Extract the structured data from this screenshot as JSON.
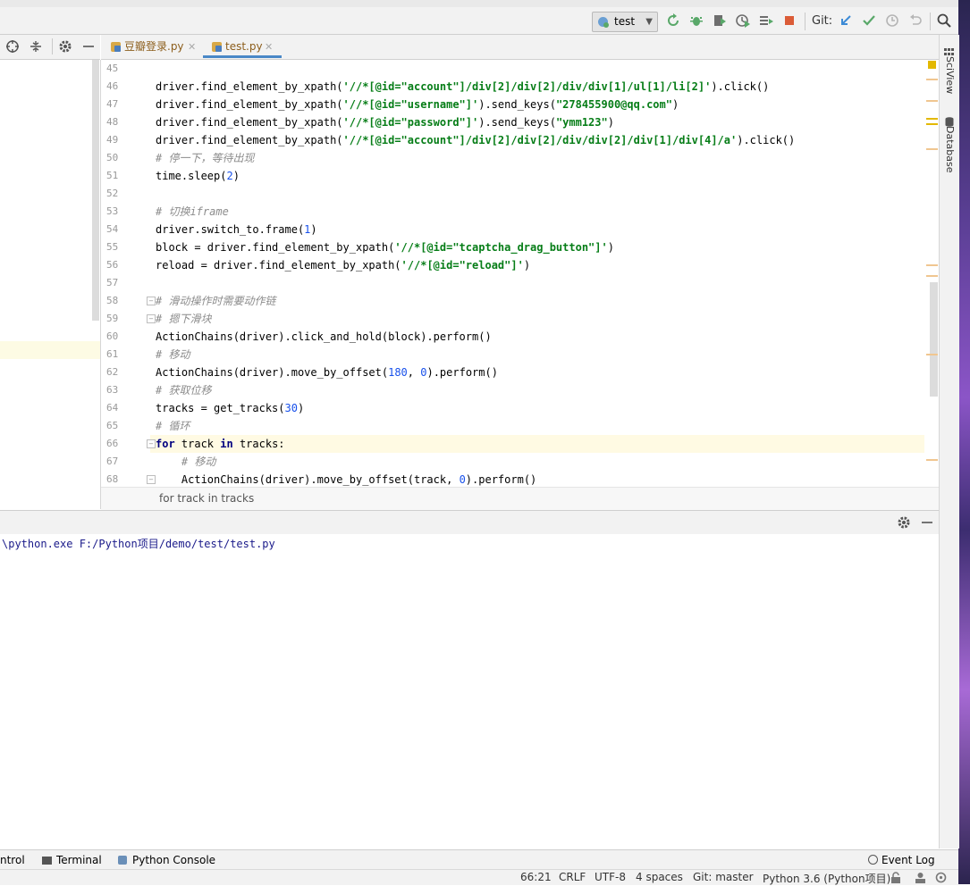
{
  "toolbar": {
    "run_config": "test",
    "git_label": "Git:"
  },
  "tabs": [
    {
      "label": "豆瓣登录.py",
      "active": false
    },
    {
      "label": "test.py",
      "active": true
    }
  ],
  "right_strip": {
    "sciview": "SciView",
    "database": "Database"
  },
  "editor": {
    "first_line": 45,
    "lines": [
      {
        "n": "45",
        "html": ""
      },
      {
        "n": "46",
        "html": "driver.find_element_by_xpath(<span class=\"str\">'//*[@id=\"account\"]/div[2]/div[2]/div/div[1]/ul[1]/li[2]'</span>).click()"
      },
      {
        "n": "47",
        "html": "driver.find_element_by_xpath(<span class=\"str\">'//*[@id=\"username\"]'</span>).send_keys(<span class=\"str\">\"278455900@qq.com\"</span>)"
      },
      {
        "n": "48",
        "html": "driver.find_element_by_xpath(<span class=\"str\">'//*[@id=\"password\"]'</span>).send_keys(<span class=\"str\">\"ymm123\"</span>)"
      },
      {
        "n": "49",
        "html": "driver.find_element_by_xpath(<span class=\"str\">'//*[@id=\"account\"]/div[2]/div[2]/div/div[2]/div[1]/div[4]/a'</span>).click()"
      },
      {
        "n": "50",
        "html": "<span class=\"cm\"># 停一下，等待出现</span>"
      },
      {
        "n": "51",
        "html": "time.sleep(<span class=\"num\">2</span>)"
      },
      {
        "n": "52",
        "html": ""
      },
      {
        "n": "53",
        "html": "<span class=\"cm\"># 切换iframe</span>"
      },
      {
        "n": "54",
        "html": "driver.switch_to.frame(<span class=\"num\">1</span>)"
      },
      {
        "n": "55",
        "html": "block = driver.find_element_by_xpath(<span class=\"str\">'//*[@id=\"tcaptcha_drag_button\"]'</span>)"
      },
      {
        "n": "56",
        "html": "reload = driver.find_element_by_xpath(<span class=\"str\">'//*[@id=\"reload\"]'</span>)"
      },
      {
        "n": "57",
        "html": ""
      },
      {
        "n": "58",
        "html": "<span class=\"cm\"># 滑动操作时需要动作链</span>"
      },
      {
        "n": "59",
        "html": "<span class=\"cm\"># 摁下滑块</span>"
      },
      {
        "n": "60",
        "html": "ActionChains(driver).click_and_hold(block).perform()"
      },
      {
        "n": "61",
        "html": "<span class=\"cm\"># 移动</span>"
      },
      {
        "n": "62",
        "html": "ActionChains(driver).move_by_offset(<span class=\"num\">180</span>, <span class=\"num\">0</span>).perform()"
      },
      {
        "n": "63",
        "html": "<span class=\"cm\"># 获取位移</span>"
      },
      {
        "n": "64",
        "html": "tracks = get_tracks(<span class=\"num\">30</span>)"
      },
      {
        "n": "65",
        "html": "<span class=\"cm\"># 循环</span>"
      },
      {
        "n": "66",
        "html": "<span class=\"kw\">for</span> track <span class=\"kw\">in</span> tracks:"
      },
      {
        "n": "67",
        "html": "    <span class=\"cm\"># 移动</span>"
      },
      {
        "n": "68",
        "html": "    ActionChains(driver).move_by_offset(track, <span class=\"num\">0</span>).perform()"
      }
    ]
  },
  "breadcrumb": "for track in tracks",
  "run": {
    "output": "\\python.exe F:/Python项目/demo/test/test.py"
  },
  "tooltabs": {
    "control": "ntrol",
    "terminal": "Terminal",
    "python_console": "Python Console",
    "event_log": "Event Log"
  },
  "status": {
    "position": "66:21",
    "line_sep": "CRLF",
    "encoding": "UTF-8",
    "indent": "4 spaces",
    "git": "Git: master",
    "interpreter": "Python 3.6 (Python项目)"
  },
  "colors": {
    "accent": "#4a88c7",
    "string": "#067d17",
    "number": "#1750eb",
    "keyword": "#000080",
    "comment": "#8c8c8c",
    "caret_row": "#fffae3"
  }
}
